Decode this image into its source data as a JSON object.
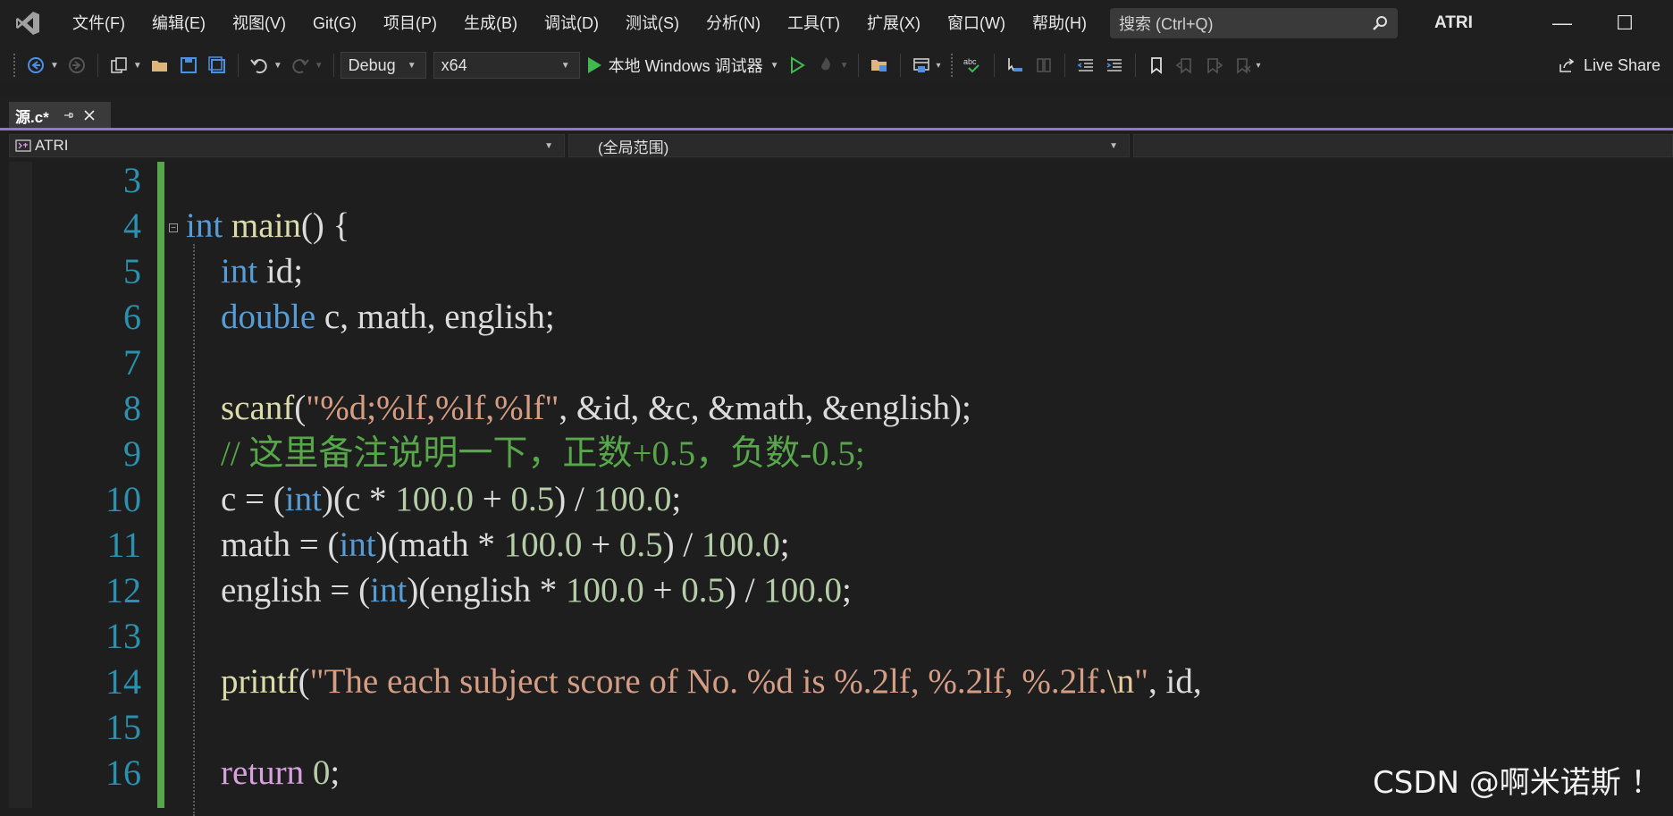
{
  "menubar": {
    "logo_icon": "visual-studio-logo",
    "items": [
      "文件(F)",
      "编辑(E)",
      "视图(V)",
      "Git(G)",
      "项目(P)",
      "生成(B)",
      "调试(D)",
      "测试(S)",
      "分析(N)",
      "工具(T)",
      "扩展(X)",
      "窗口(W)",
      "帮助(H)"
    ],
    "search_placeholder": "搜索 (Ctrl+Q)",
    "solution_name": "ATRI",
    "minimize": "—",
    "maximize": "☐"
  },
  "toolbar": {
    "config": "Debug",
    "platform": "x64",
    "run_target": "本地 Windows 调试器",
    "live_share": "Live Share"
  },
  "tabs": [
    {
      "label": "源.c*",
      "active": true,
      "pin_icon": "pin-icon",
      "close_icon": "close-icon"
    }
  ],
  "navbar": {
    "project": "ATRI",
    "scope": "(全局范围)",
    "member": ""
  },
  "editor": {
    "line_numbers": [
      "3",
      "4",
      "5",
      "6",
      "7",
      "8",
      "9",
      "10",
      "11",
      "12",
      "13",
      "14",
      "15",
      "16"
    ],
    "code": [
      "",
      "int main() {",
      "    int id;",
      "    double c, math, english;",
      "",
      "    scanf(\"%d;%lf,%lf,%lf\", &id, &c, &math, &english);",
      "    // 这里备注说明一下，正数+0.5，负数-0.5;",
      "    c = (int)(c * 100.0 + 0.5) / 100.0;",
      "    math = (int)(math * 100.0 + 0.5) / 100.0;",
      "    english = (int)(english * 100.0 + 0.5) / 100.0;",
      "",
      "    printf(\"The each subject score of No. %d is %.2lf, %.2lf, %.2lf.\\n\", id,",
      "",
      "    return 0;"
    ],
    "colors": {
      "keyword": "#569cd6",
      "function": "#dcdcaa",
      "string": "#d69d85",
      "number": "#b5cea8",
      "comment": "#57a64a",
      "line_number": "#2b91af",
      "change_bar": "#57a64a"
    }
  },
  "watermark": "CSDN @啊米诺斯 ！"
}
